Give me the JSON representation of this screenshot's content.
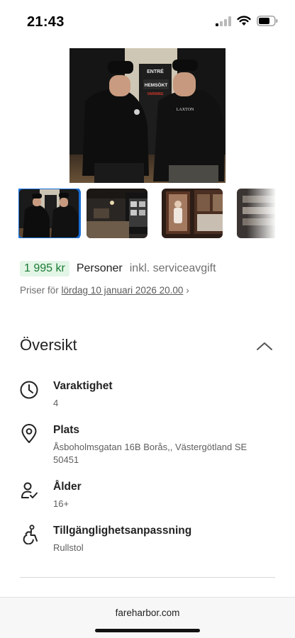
{
  "status_bar": {
    "time": "21:43",
    "icons": [
      "signal-icon",
      "wifi-icon",
      "battery-icon"
    ]
  },
  "gallery": {
    "hero_image": "two-men-in-museum-entrance-photo",
    "hero_sign_text": [
      "ENTRÉ",
      "HEMSÖKT",
      "VARNING"
    ],
    "hero_shirt_text": "LAXTON",
    "thumbnails": [
      {
        "name": "thumb-entrance",
        "selected": true
      },
      {
        "name": "thumb-exhibit-hall",
        "selected": false
      },
      {
        "name": "thumb-doll-display",
        "selected": false
      },
      {
        "name": "thumb-signs",
        "selected": false
      }
    ],
    "accent_color": "#1b6fd6"
  },
  "pricing": {
    "amount": "1 995 kr",
    "unit": "Personer",
    "fee_note": "inkl. serviceavgift",
    "date_prefix": "Priser för",
    "date_link": "lördag 10 januari 2026 20.00",
    "date_chevron": "›",
    "badge_color": "#e3f5e6",
    "amount_color": "#1a7a35"
  },
  "overview": {
    "title": "Översikt",
    "expanded": true,
    "items": [
      {
        "icon": "clock-icon",
        "label": "Varaktighet",
        "value": "4"
      },
      {
        "icon": "location-pin-icon",
        "label": "Plats",
        "value": "Åsboholmsgatan 16B Borås,, Västergötland SE 50451"
      },
      {
        "icon": "person-check-icon",
        "label": "Ålder",
        "value": "16+"
      },
      {
        "icon": "accessibility-icon",
        "label": "Tillgänglighetsanpassning",
        "value": "Rullstol"
      }
    ]
  },
  "browser": {
    "url": "fareharbor.com"
  }
}
